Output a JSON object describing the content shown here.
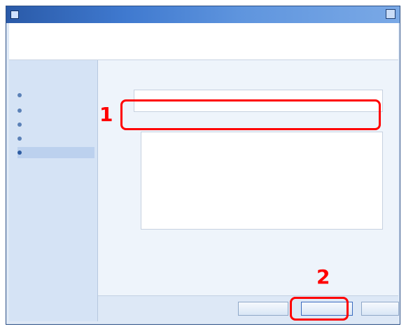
{
  "window": {
    "title": ""
  },
  "header": {
    "title": "",
    "subtitle": ""
  },
  "left_nav": {
    "heading": "",
    "items": [
      {
        "label": "",
        "active": false
      },
      {
        "label": "",
        "active": false
      },
      {
        "label": "",
        "active": false
      },
      {
        "label": "",
        "active": false
      },
      {
        "label": "",
        "active": true
      }
    ]
  },
  "main": {
    "field": {
      "label": "",
      "value": ""
    },
    "description": {
      "label": ""
    }
  },
  "buttons": {
    "back": "",
    "next": "",
    "cancel": ""
  },
  "annotations": {
    "step1": "1",
    "step2": "2"
  },
  "colors": {
    "callout": "#ff0000",
    "titlebar": "#2a5aa8"
  }
}
